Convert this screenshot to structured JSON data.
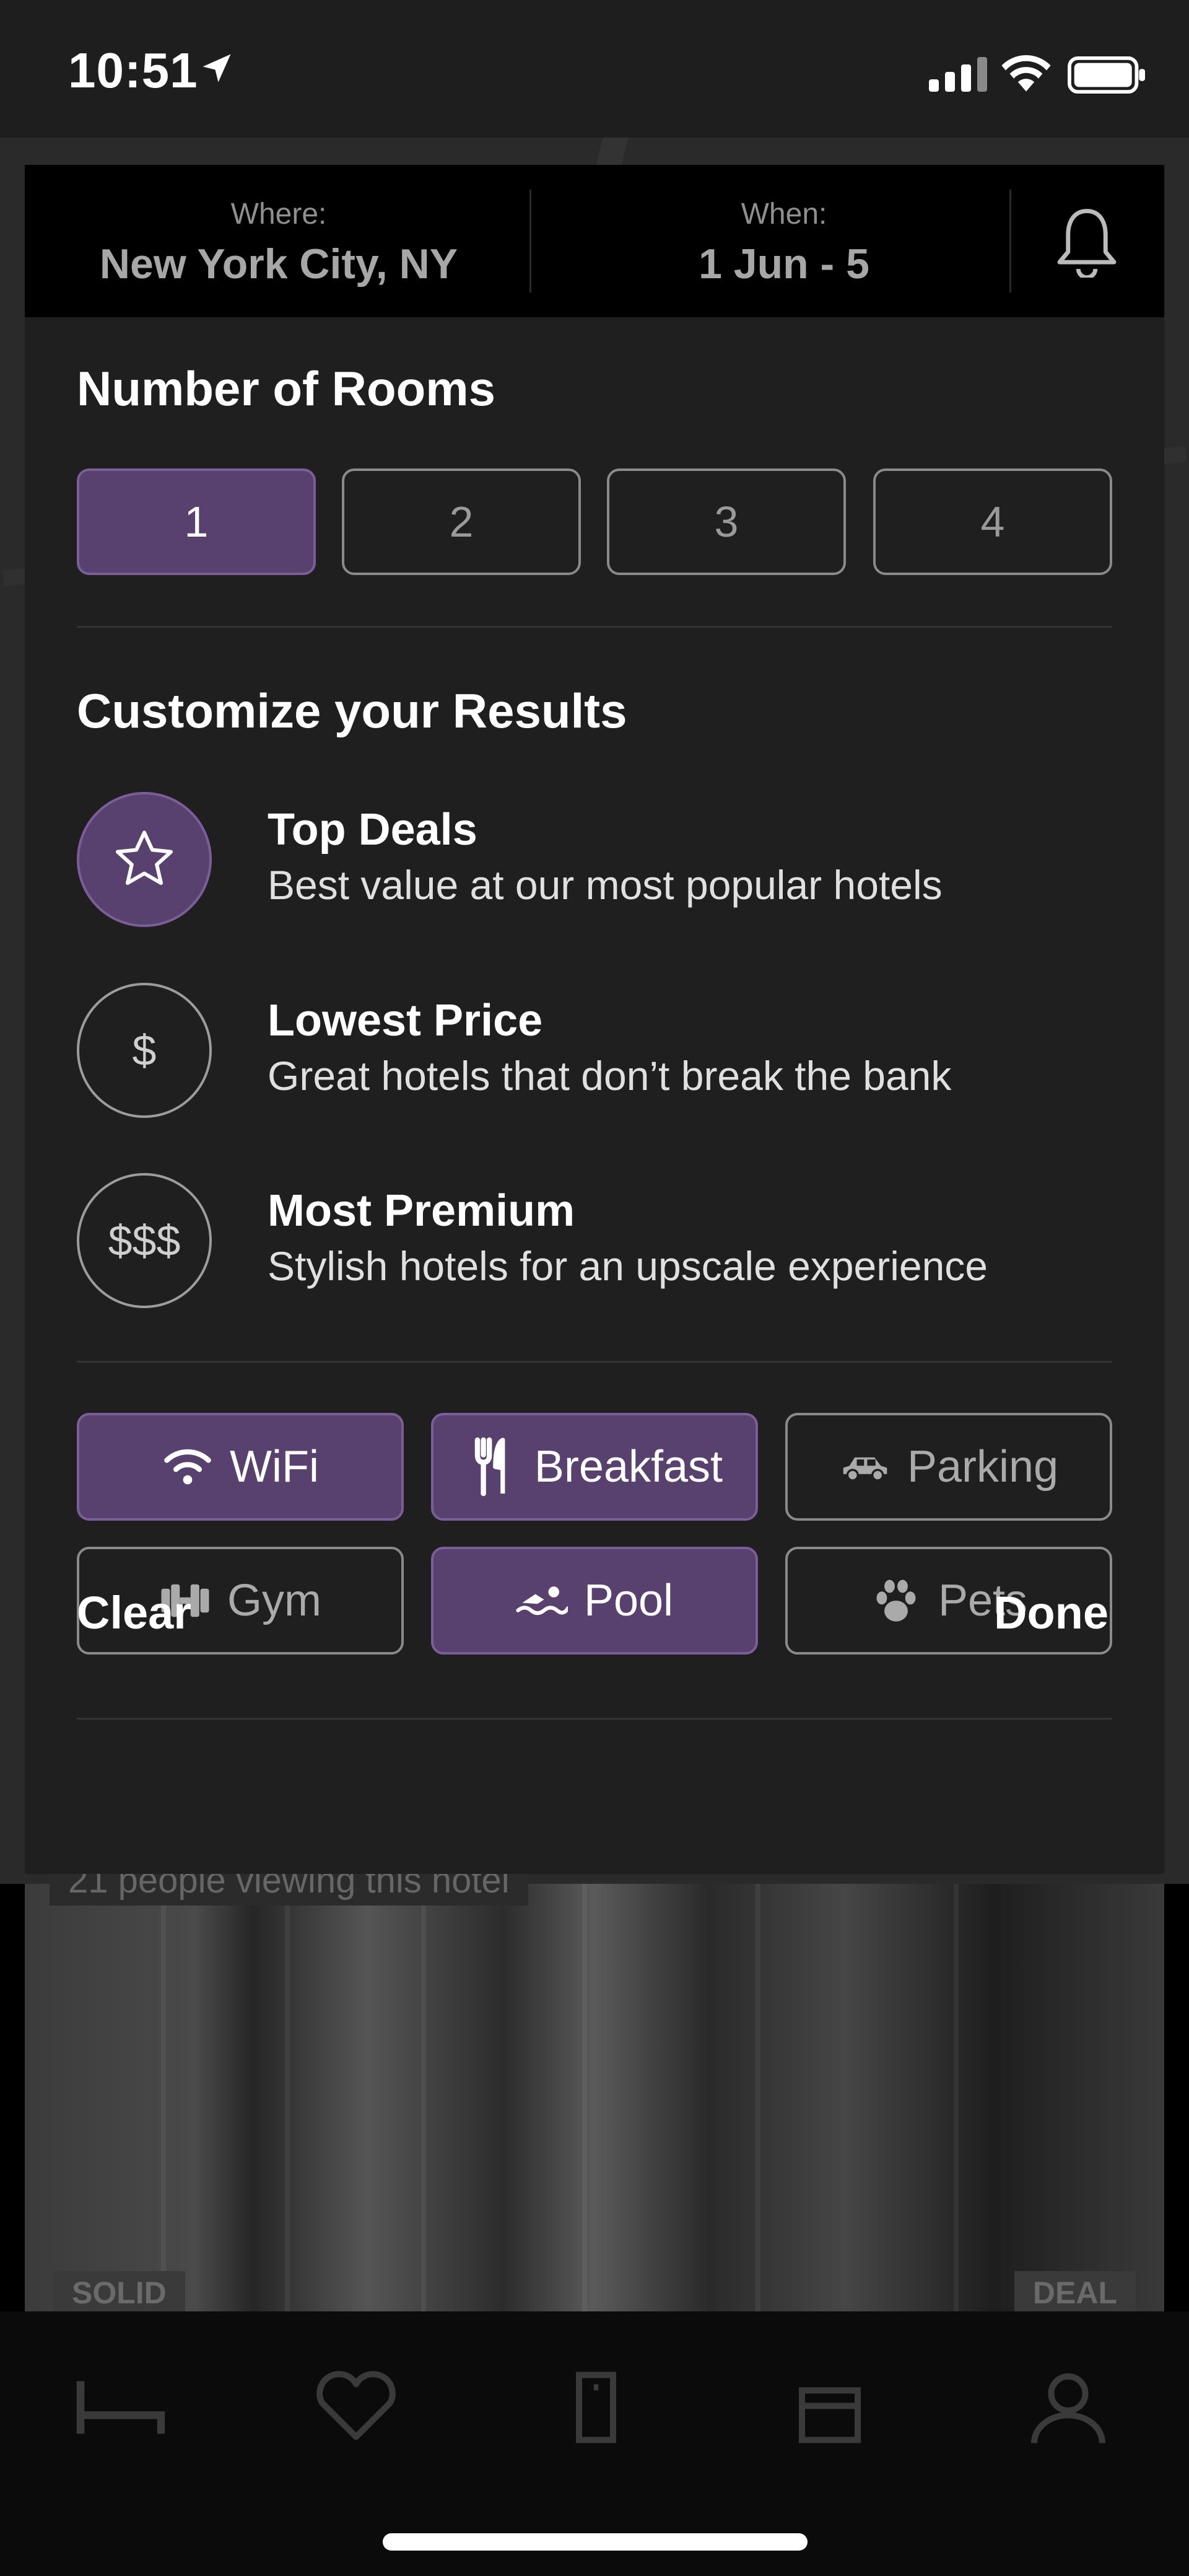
{
  "status_bar": {
    "time": "10:51"
  },
  "search": {
    "where_label": "Where:",
    "where_value": "New York City, NY",
    "when_label": "When:",
    "when_value": "1 Jun - 5"
  },
  "rooms": {
    "title": "Number of Rooms",
    "options": [
      "1",
      "2",
      "3",
      "4"
    ],
    "selected": "1"
  },
  "customize": {
    "title": "Customize your Results",
    "options": [
      {
        "title": "Top Deals",
        "description": "Best value at our most popular hotels",
        "icon": "star-icon",
        "selected": true
      },
      {
        "title": "Lowest Price",
        "description": "Great hotels that don’t break the bank",
        "icon_text": "$",
        "selected": false
      },
      {
        "title": "Most Premium",
        "description": "Stylish hotels for an upscale experience",
        "icon_text": "$$$",
        "selected": false
      }
    ]
  },
  "amenities": [
    {
      "label": "WiFi",
      "icon": "wifi-icon",
      "selected": true
    },
    {
      "label": "Breakfast",
      "icon": "fork-knife-icon",
      "selected": true
    },
    {
      "label": "Parking",
      "icon": "car-icon",
      "selected": false
    },
    {
      "label": "Gym",
      "icon": "dumbbell-icon",
      "selected": false
    },
    {
      "label": "Pool",
      "icon": "swimmer-icon",
      "selected": true
    },
    {
      "label": "Pets",
      "icon": "paw-icon",
      "selected": false
    }
  ],
  "footer": {
    "clear_label": "Clear",
    "done_label": "Done"
  },
  "background": {
    "viewing_text": "21 people viewing this hotel",
    "tag_left": "SOLID",
    "tag_right": "DEAL"
  },
  "tab_bar": {
    "icons": [
      "bed-icon",
      "heart-icon",
      "door-icon",
      "gift-icon",
      "user-icon"
    ]
  },
  "colors": {
    "accent_purple": "#58416f",
    "accent_border": "#7b5e99",
    "modal_bg": "#1f1f1f",
    "header_bg": "#000000"
  }
}
